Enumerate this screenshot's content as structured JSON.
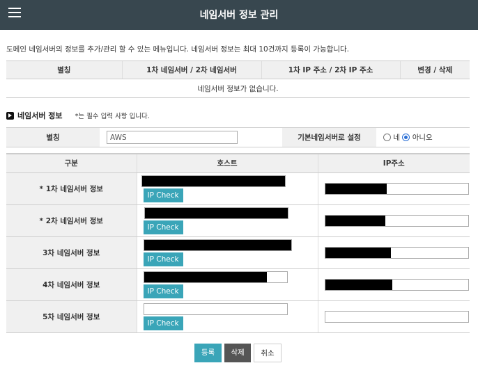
{
  "header": {
    "title": "네임서버 정보 관리",
    "menu_icon": "hamburger-menu-icon"
  },
  "description": "도메인 네임서버의 정보를 추가/관리 할 수 있는 메뉴입니다. 네임서버 정보는 최대 10건까지 등록이 가능합니다.",
  "list_table": {
    "headers": [
      "별칭",
      "1차 네임서버 / 2차 네임서버",
      "1차 IP 주소 / 2차 IP 주소",
      "변경 / 삭제"
    ],
    "empty_message": "네임서버 정보가 없습니다."
  },
  "section": {
    "title": "네임서버 정보",
    "note": "*는 필수 입력 사항 입니다."
  },
  "form": {
    "alias_label": "별칭",
    "alias_value": "AWS",
    "default_label": "기본네임서버로 설정",
    "radio_yes": "네",
    "radio_no": "아니오",
    "radio_selected": "아니오"
  },
  "ns_table": {
    "headers": [
      "구분",
      "호스트",
      "IP주소"
    ],
    "rows": [
      {
        "label": "* 1차 네임서버 정보",
        "check_label": "IP Check"
      },
      {
        "label": "* 2차 네임서버 정보",
        "check_label": "IP Check"
      },
      {
        "label": "3차 네임서버 정보",
        "check_label": "IP Check"
      },
      {
        "label": "4차 네임서버 정보",
        "check_label": "IP Check"
      },
      {
        "label": "5차 네임서버 정보",
        "check_label": "IP Check"
      }
    ]
  },
  "buttons": {
    "register": "등록",
    "delete": "삭제",
    "cancel": "취소"
  },
  "colors": {
    "header_bg": "#38474f",
    "accent": "#3aa5b8",
    "delete_btn": "#555555"
  }
}
